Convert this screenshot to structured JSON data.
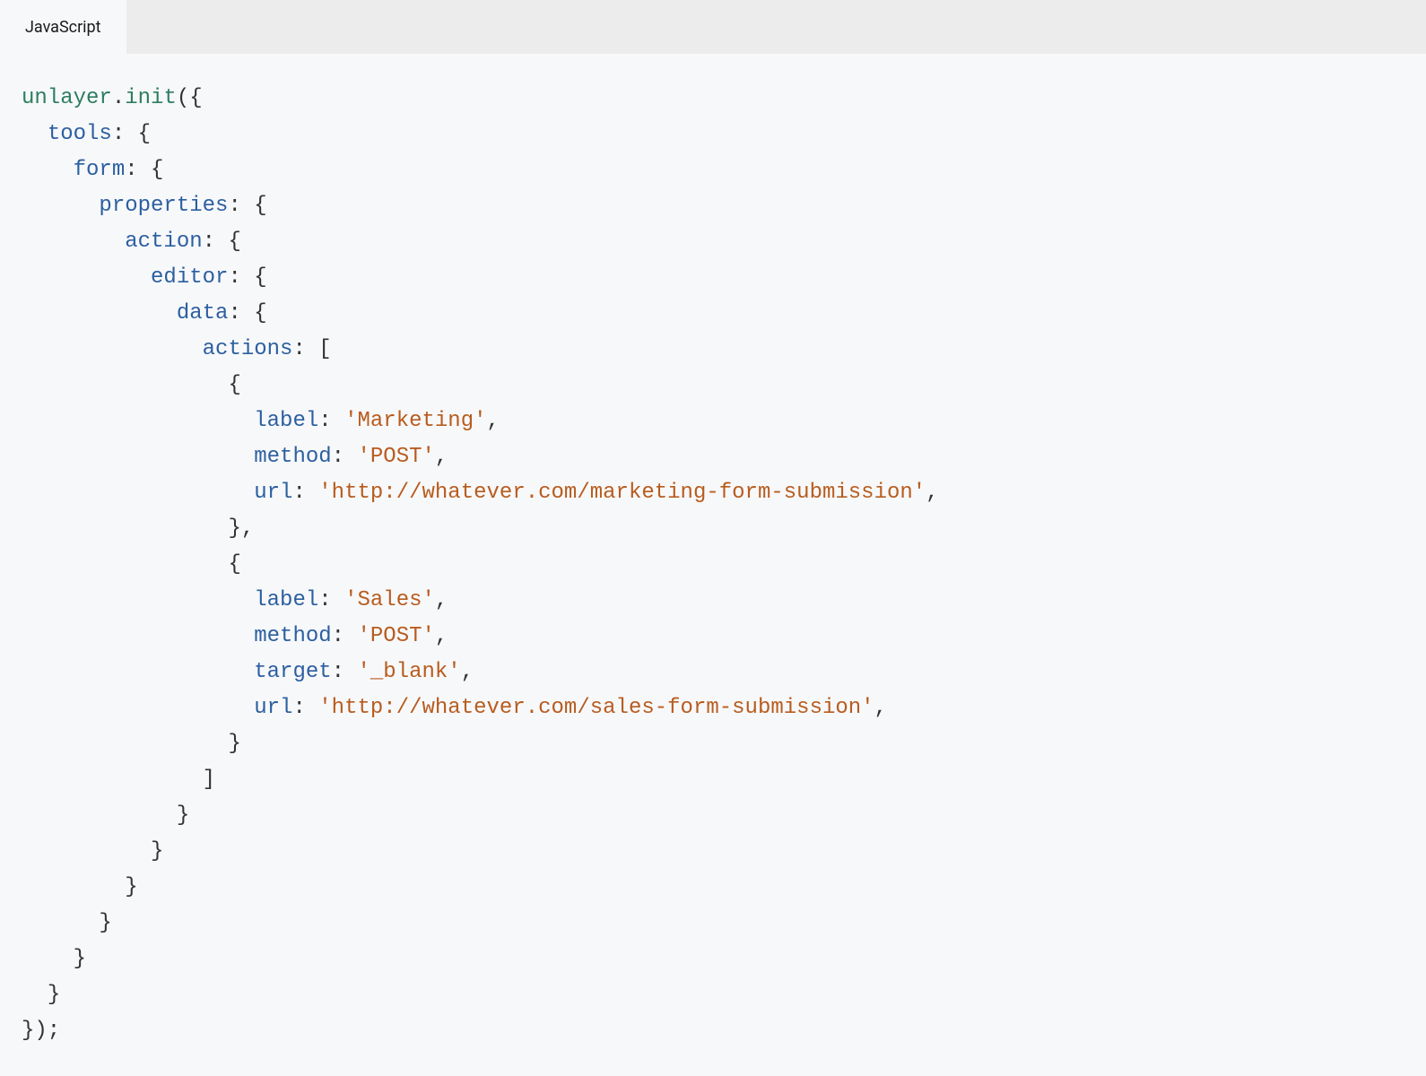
{
  "tab": {
    "label": "JavaScript"
  },
  "code": {
    "l1_obj": "unlayer",
    "l1_punc1": ".",
    "l1_method": "init",
    "l1_punc2": "({",
    "l2_prop": "tools",
    "l2_punc": ": {",
    "l3_prop": "form",
    "l3_punc": ": {",
    "l4_prop": "properties",
    "l4_punc": ": {",
    "l5_prop": "action",
    "l5_punc": ": {",
    "l6_prop": "editor",
    "l6_punc": ": {",
    "l7_prop": "data",
    "l7_punc": ": {",
    "l8_prop": "actions",
    "l8_punc": ": [",
    "l9_punc": "{",
    "l10_prop": "label",
    "l10_punc1": ": ",
    "l10_str": "'Marketing'",
    "l10_punc2": ",",
    "l11_prop": "method",
    "l11_punc1": ": ",
    "l11_str": "'POST'",
    "l11_punc2": ",",
    "l12_prop": "url",
    "l12_punc1": ": ",
    "l12_str": "'http://whatever.com/marketing-form-submission'",
    "l12_punc2": ",",
    "l13_punc": "},",
    "l14_punc": "{",
    "l15_prop": "label",
    "l15_punc1": ": ",
    "l15_str": "'Sales'",
    "l15_punc2": ",",
    "l16_prop": "method",
    "l16_punc1": ": ",
    "l16_str": "'POST'",
    "l16_punc2": ",",
    "l17_prop": "target",
    "l17_punc1": ": ",
    "l17_str": "'_blank'",
    "l17_punc2": ",",
    "l18_prop": "url",
    "l18_punc1": ": ",
    "l18_str": "'http://whatever.com/sales-form-submission'",
    "l18_punc2": ",",
    "l19_punc": "}",
    "l20_punc": "]",
    "l21_punc": "}",
    "l22_punc": "}",
    "l23_punc": "}",
    "l24_punc": "}",
    "l25_punc": "}",
    "l26_punc": "}",
    "l27_punc": "});"
  }
}
